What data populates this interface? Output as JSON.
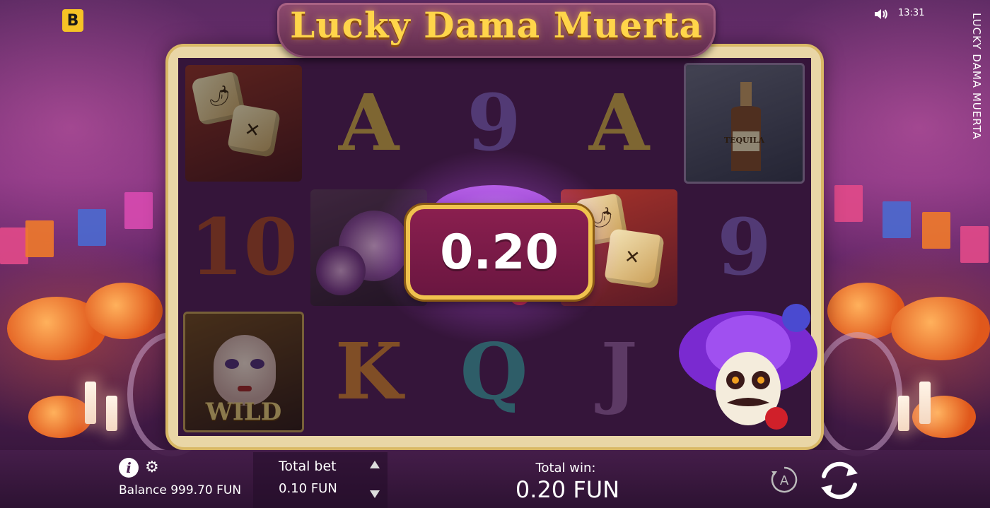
{
  "brand": {
    "badge": "B"
  },
  "game": {
    "title": "Lucky Dama Muerta",
    "side_title": "LUCKY DAMA MUERTA"
  },
  "status": {
    "clock": "13:31"
  },
  "reels": {
    "columns": [
      [
        "dice",
        "10",
        "wild"
      ],
      [
        "A",
        "dahlia",
        "K"
      ],
      [
        "9",
        "skull-sombrero",
        "Q"
      ],
      [
        "A",
        "dice",
        "J"
      ],
      [
        "tequila",
        "9",
        "skull-sombrero"
      ]
    ],
    "wild_label": "WILD",
    "tequila_label": "TEQUILA"
  },
  "win_popup": {
    "amount": "0.20"
  },
  "controls": {
    "balance": "Balance 999.70 FUN",
    "total_bet_label": "Total bet",
    "total_bet_value": "0.10 FUN",
    "total_win_label": "Total win:",
    "total_win_value": "0.20 FUN",
    "autoplay_letter": "A"
  },
  "colors": {
    "gold": "#f0c24e",
    "title_gold": "#ffd54a",
    "bubble": "#7a1b47",
    "badge": "#f6c325"
  },
  "icons": [
    "info-icon",
    "gear-icon",
    "sound-icon",
    "autoplay-icon",
    "spin-icon",
    "arrow-up-icon",
    "arrow-down-icon"
  ]
}
